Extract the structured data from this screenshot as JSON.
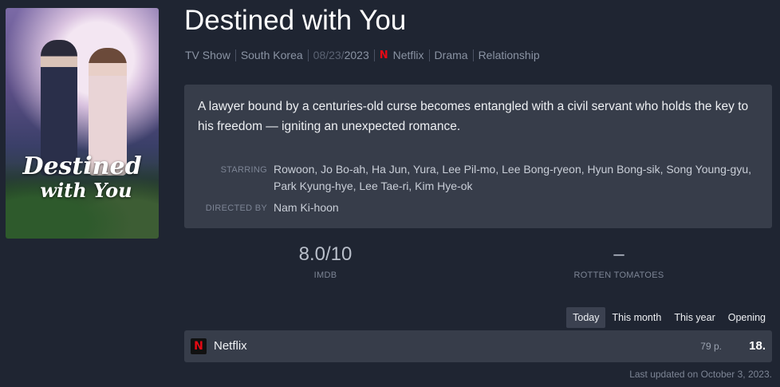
{
  "poster": {
    "title_line1": "Destined",
    "title_line2": "with You"
  },
  "title": "Destined with You",
  "meta": {
    "type": "TV Show",
    "country": "South Korea",
    "date_dim": "08/23/",
    "date_year": "2023",
    "network_icon": "N",
    "network": "Netflix",
    "genre1": "Drama",
    "genre2": "Relationship"
  },
  "synopsis": "A lawyer bound by a centuries-old curse becomes entangled with a civil servant who holds the key to his freedom — igniting an unexpected romance.",
  "credits": {
    "starring_label": "STARRING",
    "starring": "Rowoon, Jo Bo-ah, Ha Jun, Yura, Lee Pil-mo, Lee Bong-ryeon, Hyun Bong-sik, Song Young-gyu, Park Kyung-hye, Lee Tae-ri, Kim Hye-ok",
    "directed_label": "DIRECTED BY",
    "director": "Nam Ki-hoon"
  },
  "ratings": {
    "imdb_score": "8.0/10",
    "imdb_label": "IMDB",
    "rt_score": "–",
    "rt_label": "ROTTEN TOMATOES"
  },
  "tabs": [
    "Today",
    "This month",
    "This year",
    "Opening"
  ],
  "ranking": {
    "icon": "N",
    "service": "Netflix",
    "points": "79 p.",
    "rank": "18."
  },
  "last_updated": "Last updated on October 3, 2023.",
  "colors": {
    "background": "#1f2532",
    "panel": "#373d4a",
    "netflix_red": "#e50914"
  }
}
